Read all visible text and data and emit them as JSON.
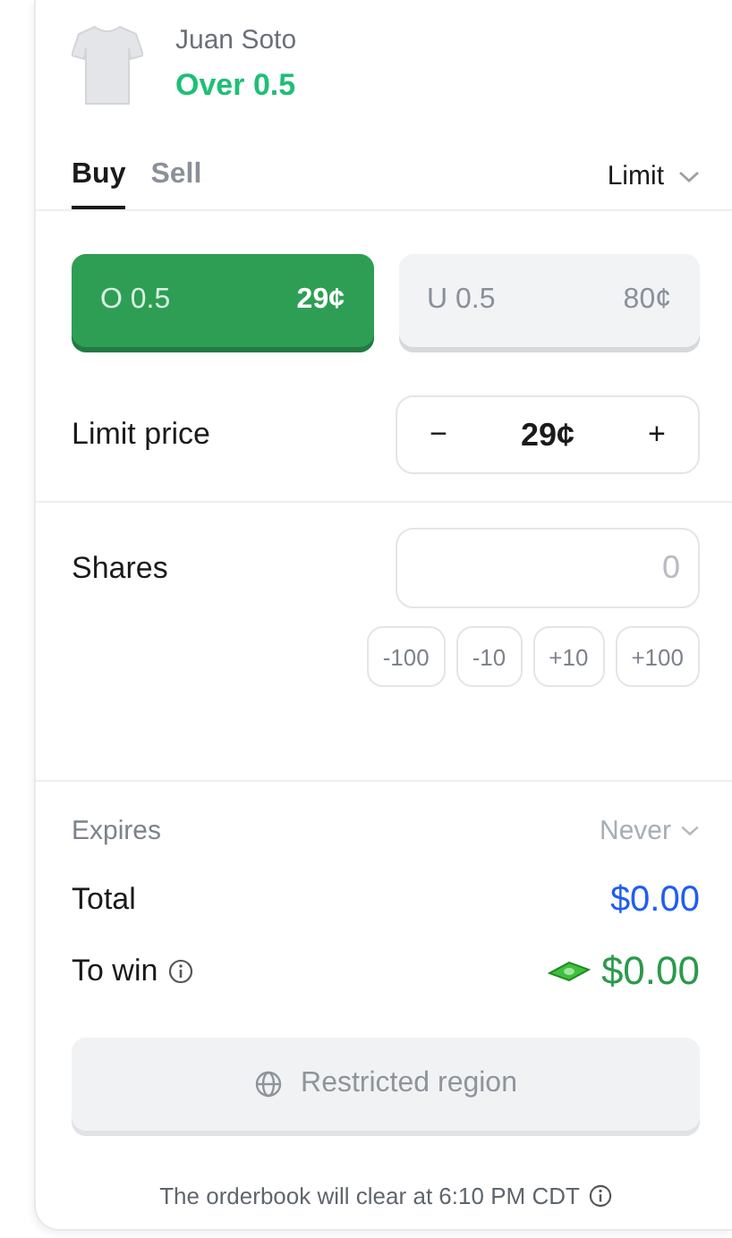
{
  "header": {
    "player": "Juan Soto",
    "line": "Over 0.5"
  },
  "tabs": [
    {
      "label": "Buy",
      "selected": true
    },
    {
      "label": "Sell",
      "selected": false
    }
  ],
  "order_type": {
    "label": "Limit"
  },
  "outcomes": [
    {
      "label": "O 0.5",
      "price": "29¢",
      "selected": true
    },
    {
      "label": "U 0.5",
      "price": "80¢",
      "selected": false
    }
  ],
  "limit_price": {
    "label": "Limit price",
    "decrement": "−",
    "value": "29¢",
    "increment": "+"
  },
  "shares": {
    "label": "Shares",
    "placeholder": "0",
    "quick": [
      "-100",
      "-10",
      "+10",
      "+100"
    ]
  },
  "expires": {
    "label": "Expires",
    "value": "Never"
  },
  "total": {
    "label": "Total",
    "value": "$0.00"
  },
  "to_win": {
    "label": "To win",
    "value": "$0.00"
  },
  "submit": {
    "label": "Restricted region",
    "disabled": true
  },
  "footer": "The orderbook will clear at 6:10 PM CDT"
}
